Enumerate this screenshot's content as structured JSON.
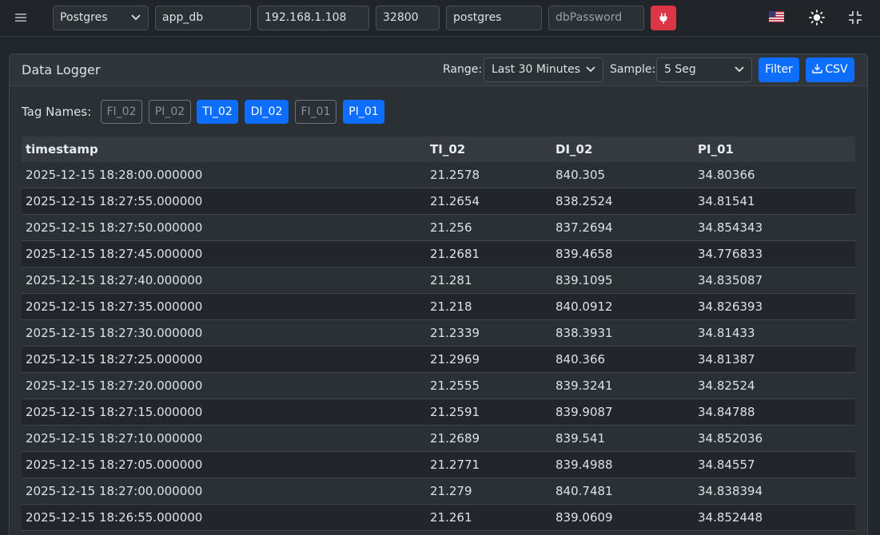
{
  "connection": {
    "db_type": "Postgres",
    "database": "app_db",
    "host": "192.168.1.108",
    "port": "32800",
    "user": "postgres",
    "password_placeholder": "dbPassword"
  },
  "icons": {
    "menu": "hamburger-icon",
    "connect": "plug-icon",
    "language": "us-flag-icon",
    "theme": "sun-icon",
    "fullscreen": "shrink-icon"
  },
  "colors": {
    "primary": "#0d6efd",
    "danger": "#dc3545"
  },
  "logger": {
    "title": "Data Logger",
    "range_label": "Range:",
    "range_value": "Last 30 Minutes",
    "sample_label": "Sample:",
    "sample_value": "5 Seg",
    "filter_label": "Filter",
    "csv_label": "CSV",
    "tags_label": "Tag Names:",
    "tags": [
      {
        "name": "FI_02",
        "selected": false
      },
      {
        "name": "PI_02",
        "selected": false
      },
      {
        "name": "TI_02",
        "selected": true
      },
      {
        "name": "DI_02",
        "selected": true
      },
      {
        "name": "FI_01",
        "selected": false
      },
      {
        "name": "PI_01",
        "selected": true
      }
    ]
  },
  "table": {
    "columns": [
      "timestamp",
      "TI_02",
      "DI_02",
      "PI_01"
    ],
    "rows": [
      [
        "2025-12-15 18:28:00.000000",
        "21.2578",
        "840.305",
        "34.80366"
      ],
      [
        "2025-12-15 18:27:55.000000",
        "21.2654",
        "838.2524",
        "34.81541"
      ],
      [
        "2025-12-15 18:27:50.000000",
        "21.256",
        "837.2694",
        "34.854343"
      ],
      [
        "2025-12-15 18:27:45.000000",
        "21.2681",
        "839.4658",
        "34.776833"
      ],
      [
        "2025-12-15 18:27:40.000000",
        "21.281",
        "839.1095",
        "34.835087"
      ],
      [
        "2025-12-15 18:27:35.000000",
        "21.218",
        "840.0912",
        "34.826393"
      ],
      [
        "2025-12-15 18:27:30.000000",
        "21.2339",
        "838.3931",
        "34.81433"
      ],
      [
        "2025-12-15 18:27:25.000000",
        "21.2969",
        "840.366",
        "34.81387"
      ],
      [
        "2025-12-15 18:27:20.000000",
        "21.2555",
        "839.3241",
        "34.82524"
      ],
      [
        "2025-12-15 18:27:15.000000",
        "21.2591",
        "839.9087",
        "34.84788"
      ],
      [
        "2025-12-15 18:27:10.000000",
        "21.2689",
        "839.541",
        "34.852036"
      ],
      [
        "2025-12-15 18:27:05.000000",
        "21.2771",
        "839.4988",
        "34.84557"
      ],
      [
        "2025-12-15 18:27:00.000000",
        "21.279",
        "840.7481",
        "34.838394"
      ],
      [
        "2025-12-15 18:26:55.000000",
        "21.261",
        "839.0609",
        "34.852448"
      ]
    ]
  }
}
